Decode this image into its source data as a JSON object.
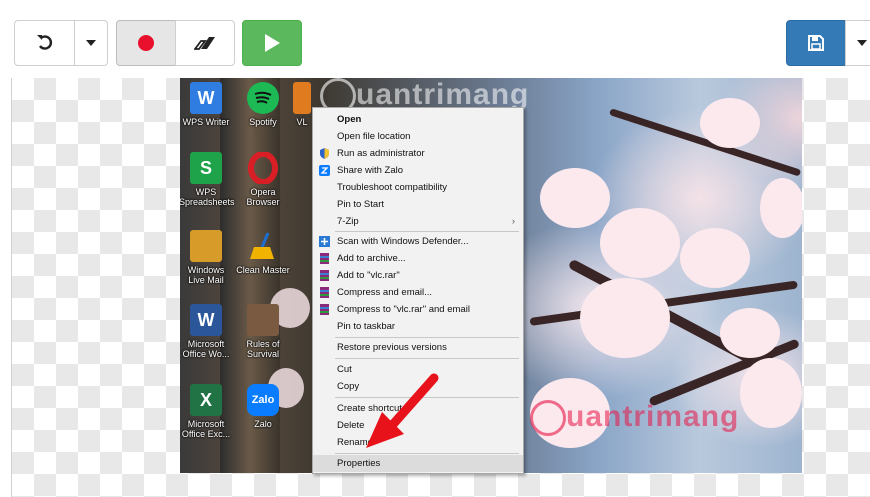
{
  "toolbar": {
    "undo_icon": "undo-icon",
    "dropdown_icon": "chevron-down-icon",
    "record_icon": "record-icon",
    "eraser_icon": "eraser-icon",
    "play_icon": "play-icon",
    "save_icon": "save-icon",
    "colors": {
      "play_bg": "#5cb85c",
      "save_bg": "#337ab7",
      "record": "#e8102c"
    }
  },
  "desktop_icons": [
    {
      "label": "WPS Writer",
      "letter": "W",
      "color": "#2f7de1"
    },
    {
      "label": "Spotify",
      "letter": "",
      "color": "#1db954"
    },
    {
      "label": "WPS Spreadsheets",
      "letter": "S",
      "color": "#1fa34a"
    },
    {
      "label": "Opera Browser",
      "letter": "O",
      "color": "#d81f26"
    },
    {
      "label": "Windows Live Mail",
      "letter": "",
      "color": "#d79b2a"
    },
    {
      "label": "Clean Master",
      "letter": "",
      "color": "#1d6fd1"
    },
    {
      "label": "Microsoft Office Wo...",
      "letter": "W",
      "color": "#2b579a"
    },
    {
      "label": "Rules of Survival",
      "letter": "",
      "color": "#7a5a40"
    },
    {
      "label": "Microsoft Office Exc...",
      "letter": "X",
      "color": "#217346"
    },
    {
      "label": "Zalo",
      "letter": "Zalo",
      "color": "#0a7cff"
    },
    {
      "label": "VL",
      "letter": "",
      "color": "#e07b1f"
    }
  ],
  "context_menu": {
    "items": [
      {
        "label": "Open",
        "bold": true
      },
      {
        "label": "Open file location"
      },
      {
        "label": "Run as administrator",
        "icon": "shield-icon"
      },
      {
        "label": "Share with Zalo",
        "icon": "zalo-icon"
      },
      {
        "label": "Troubleshoot compatibility"
      },
      {
        "label": "Pin to Start"
      },
      {
        "label": "7-Zip",
        "submenu": true
      },
      {
        "label": "Scan with Windows Defender...",
        "icon": "defender-icon"
      },
      {
        "label": "Add to archive...",
        "icon": "winrar-icon"
      },
      {
        "label": "Add to \"vlc.rar\"",
        "icon": "winrar-icon"
      },
      {
        "label": "Compress and email...",
        "icon": "winrar-icon"
      },
      {
        "label": "Compress to \"vlc.rar\" and email",
        "icon": "winrar-icon"
      },
      {
        "label": "Pin to taskbar"
      },
      {
        "label": "Restore previous versions"
      },
      {
        "label": "Cut"
      },
      {
        "label": "Copy"
      },
      {
        "label": "Create shortcut"
      },
      {
        "label": "Delete"
      },
      {
        "label": "Rename"
      },
      {
        "label": "Properties",
        "highlighted": true
      }
    ]
  },
  "watermark": {
    "top": "uantrimang",
    "bottom": "uantrimang"
  },
  "annotation": {
    "arrow_color": "#e8121b"
  }
}
